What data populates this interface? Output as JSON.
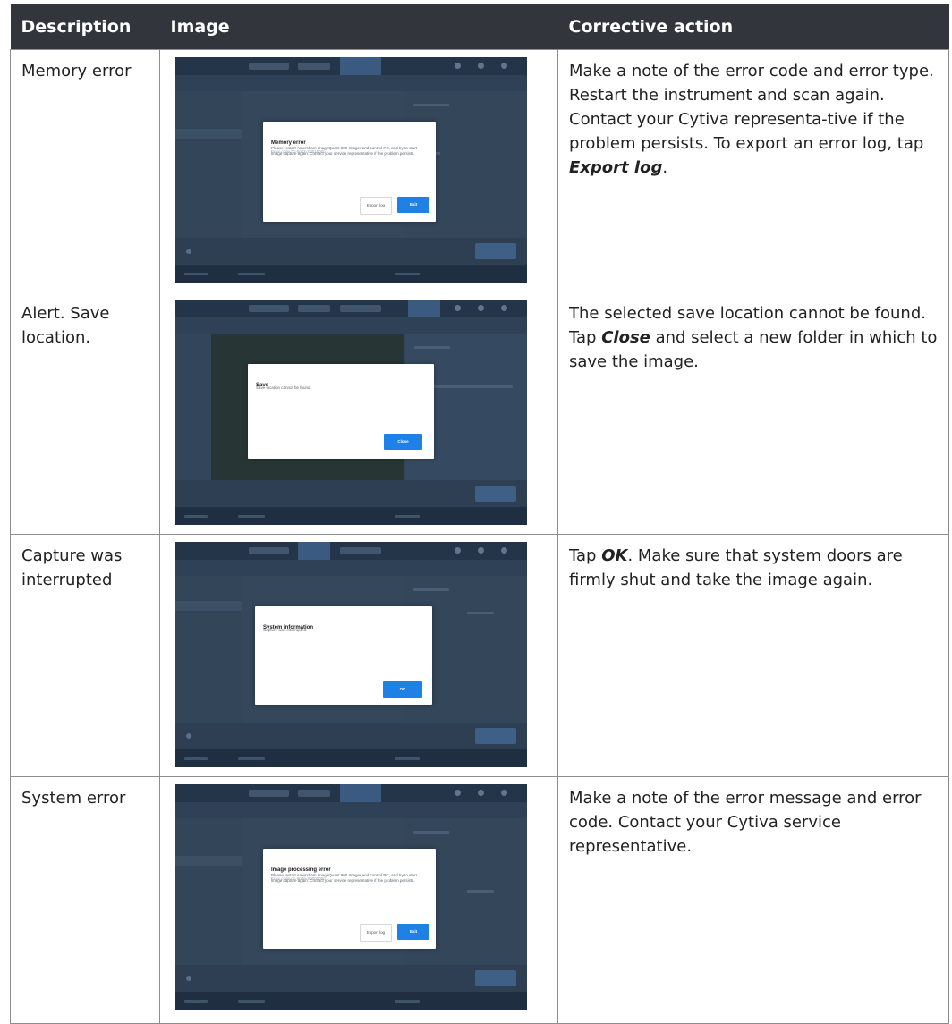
{
  "table": {
    "headers": {
      "description": "Description",
      "image": "Image",
      "action": "Corrective action"
    },
    "rows": [
      {
        "description": "Memory error",
        "action": [
          {
            "t": "Make a note of the error code and error type. Restart the instrument and scan again. Contact your Cytiva representa-tive if the problem persists. To export an error log, tap "
          },
          {
            "t": "Export log",
            "em": true
          },
          {
            "t": "."
          }
        ],
        "screenshot": {
          "title": "Memory error",
          "code": "Error code 01-0002-S0010000",
          "body": "Please restart Amersham ImageQuant 800 Imager and control PC, and try to start image capture again. Contact your service representative if the problem persists.",
          "secondary_button": "Export log",
          "primary_button": "Exit"
        }
      },
      {
        "description": "Alert. Save location.",
        "action": [
          {
            "t": "The selected save location cannot be found. Tap "
          },
          {
            "t": "Close",
            "em": true
          },
          {
            "t": " and select a new folder in which to save the image."
          }
        ],
        "screenshot": {
          "title": "Save",
          "body": "Save location cannot be found.",
          "primary_button": "Close"
        }
      },
      {
        "description": "Capture was interrupted",
        "action": [
          {
            "t": "Tap "
          },
          {
            "t": "OK",
            "em": true
          },
          {
            "t": ". Make sure that system doors are firmly shut and take the image again."
          }
        ],
        "screenshot": {
          "title": "System information",
          "body": "Capture was interrupted.",
          "primary_button": "OK"
        }
      },
      {
        "description": "System error",
        "action": [
          {
            "t": "Make a note of the error message and error code. Contact your Cytiva service representative."
          }
        ],
        "screenshot": {
          "title": "Image processing error",
          "code": "Error code 01-8000-S0000000",
          "body": "Please restart Amersham ImageQuant 800 Imager and control PC, and try to start image capture again. Contact your service representative if the problem persists.",
          "secondary_button": "Export log",
          "primary_button": "Exit"
        }
      }
    ]
  }
}
